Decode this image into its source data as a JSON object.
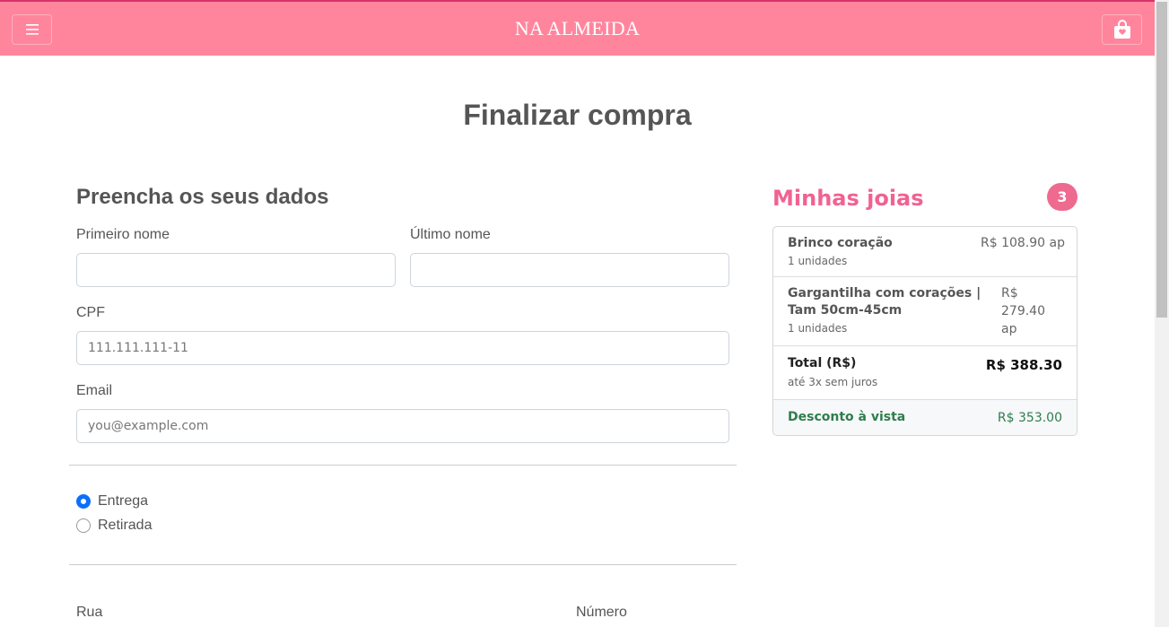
{
  "header": {
    "brand": "NA ALMEIDA",
    "accent_color": "#ff859d",
    "menu_icon": "hamburger-icon",
    "bag_icon": "shopping-bag-icon"
  },
  "page": {
    "title": "Finalizar compra"
  },
  "form": {
    "section_title": "Preencha os seus dados",
    "first_name_label": "Primeiro nome",
    "first_name_value": "",
    "last_name_label": "Último nome",
    "last_name_value": "",
    "cpf_label": "CPF",
    "cpf_placeholder": "111.111.111-11",
    "email_label": "Email",
    "email_placeholder": "you@example.com",
    "delivery_options": [
      {
        "label": "Entrega",
        "checked": true
      },
      {
        "label": "Retirada",
        "checked": false
      }
    ],
    "street_label": "Rua",
    "number_label": "Número"
  },
  "cart": {
    "title": "Minhas joias",
    "count": "3",
    "items": [
      {
        "name": "Brinco coração",
        "qty": "1 unidades",
        "price": "R$ 108.90 ap"
      },
      {
        "name": "Gargantilha com corações | Tam 50cm-45cm",
        "qty": "1 unidades",
        "price": "R$ 279.40 ap"
      }
    ],
    "total": {
      "label": "Total (R$)",
      "sub": "até 3x sem juros",
      "value": "R$ 388.30"
    },
    "discount": {
      "label": "Desconto à vista",
      "value": "R$ 353.00",
      "color": "#2e7d4f"
    }
  }
}
